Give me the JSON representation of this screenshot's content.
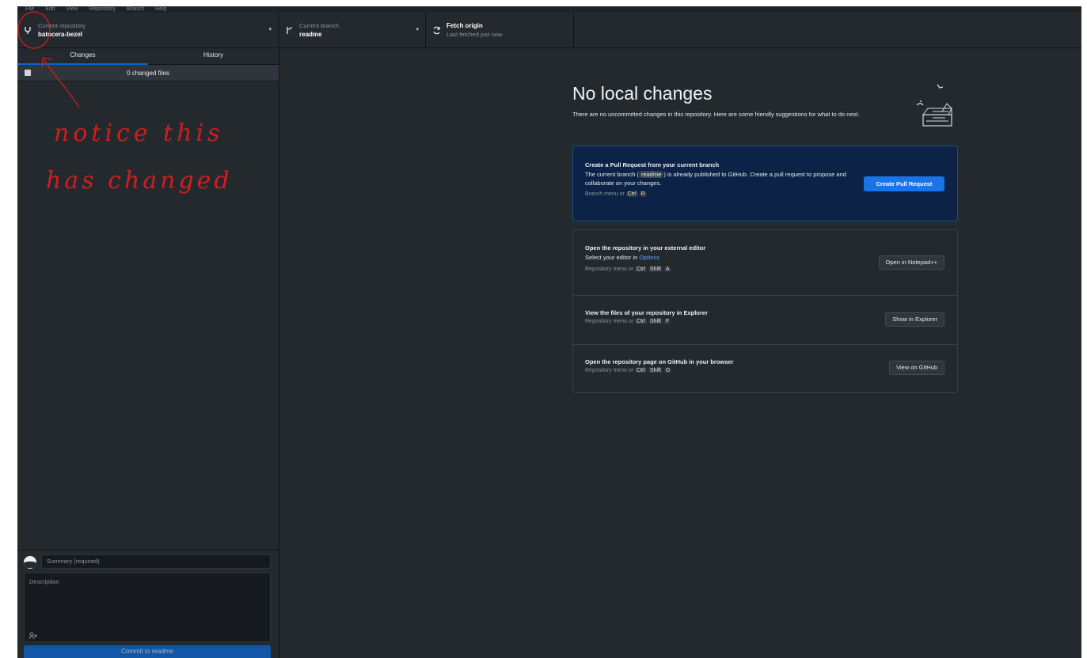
{
  "menu": {
    "items": [
      "File",
      "Edit",
      "View",
      "Repository",
      "Branch",
      "Help"
    ]
  },
  "toolbar": {
    "repo": {
      "label": "Current repository",
      "value": "batocera-bezel"
    },
    "branch": {
      "label": "Current branch",
      "value": "readme"
    },
    "fetch": {
      "label": "Fetch origin",
      "sub": "Last fetched just now"
    }
  },
  "sidebar": {
    "tabs": [
      "Changes",
      "History"
    ],
    "changed_files": "0 changed files",
    "commit": {
      "summary_placeholder": "Summary (required)",
      "description_placeholder": "Description",
      "commit_button": "Commit to readme"
    }
  },
  "annotation": {
    "line1": "notice this",
    "line2": "has changed",
    "color": "#d11e1e"
  },
  "main": {
    "title": "No local changes",
    "description": "There are no uncommitted changes in this repository. Here are some friendly suggestions for what to do next.",
    "pr_card": {
      "title": "Create a Pull Request from your current branch",
      "desc_before": "The current branch (",
      "branch": "readme",
      "desc_after": ") is already published to GitHub. Create a pull request to propose and collaborate on your changes.",
      "hint_prefix": "Branch menu or",
      "keys": [
        "Ctrl",
        "R"
      ],
      "button": "Create Pull Request"
    },
    "actions": [
      {
        "title": "Open the repository in your external editor",
        "subtitle_prefix": "Select your editor in",
        "subtitle_link": "Options",
        "hint_prefix": "Repository menu or",
        "keys": [
          "Ctrl",
          "Shift",
          "A"
        ],
        "button": "Open in Notepad++"
      },
      {
        "title": "View the files of your repository in Explorer",
        "hint_prefix": "Repository menu or",
        "keys": [
          "Ctrl",
          "Shift",
          "F"
        ],
        "button": "Show in Explorer"
      },
      {
        "title": "Open the repository page on GitHub in your browser",
        "hint_prefix": "Repository menu or",
        "keys": [
          "Ctrl",
          "Shift",
          "G"
        ],
        "button": "View on GitHub"
      }
    ]
  },
  "colors": {
    "background": "#24292e",
    "accent": "#1b73e8",
    "pr_card": "#0c2347"
  }
}
